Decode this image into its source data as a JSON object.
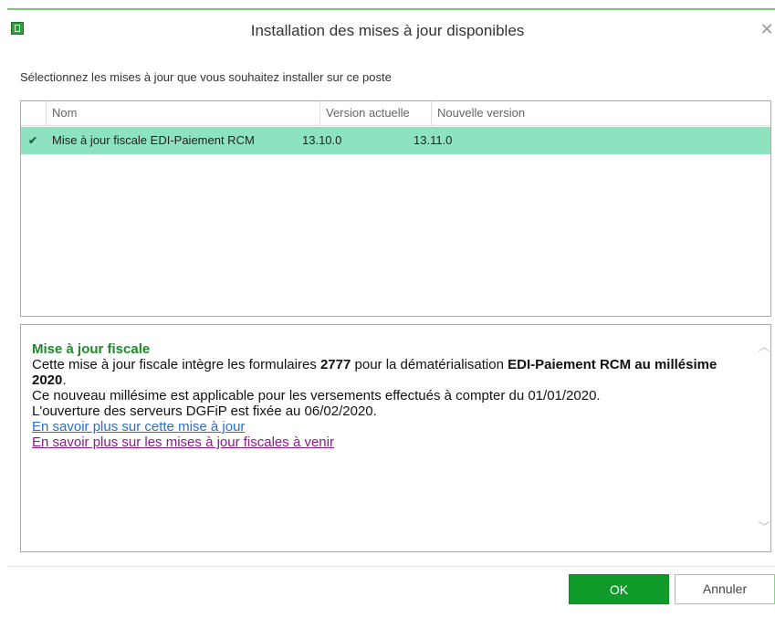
{
  "window": {
    "title": "Installation des mises à jour disponibles",
    "close_glyph": "✕",
    "app_icon": "app-icon"
  },
  "instruction": "Sélectionnez les mises à jour que vous souhaitez installer sur ce poste",
  "table": {
    "columns": [
      "",
      "Nom",
      "Version actuelle",
      "Nouvelle version"
    ],
    "rows": [
      {
        "checked": true,
        "check_glyph": "✔",
        "name": "Mise à jour fiscale EDI-Paiement RCM",
        "current": "13.10.0",
        "new": "13.11.0"
      }
    ],
    "selected_row_color": "#8de2bf"
  },
  "description": {
    "title": "Mise à jour fiscale",
    "line1_pre": "Cette mise à jour fiscale intègre les formulaires ",
    "line1_b1": "2777",
    "line1_mid": " pour la dématérialisation ",
    "line1_b2": "EDI-Paiement RCM au millésime 2020",
    "line1_end": ".",
    "line2": "Ce nouveau millésime est applicable pour les versements effectués à compter du 01/01/2020.",
    "line3": "L'ouverture des serveurs DGFiP est fixée au 06/02/2020.",
    "link1": "En savoir plus sur cette mise à jour",
    "link2": "En savoir plus sur les mises à jour fiscales à venir",
    "scroll_up_glyph": "︿",
    "scroll_down_glyph": "﹀"
  },
  "buttons": {
    "ok": "OK",
    "cancel": "Annuler"
  },
  "colors": {
    "accent": "#0f9a2a",
    "title_green": "#1f8a2a",
    "link_blue": "#2a6fcf",
    "link_purple": "#8b1a8b"
  }
}
